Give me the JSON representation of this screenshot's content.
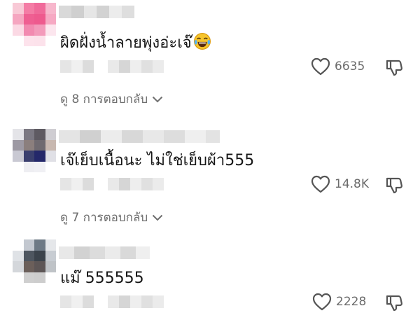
{
  "comments": [
    {
      "text": "ผิดฝั่งน้ำลายพุ่งอ่ะเจ๊",
      "emoji": "face-with-tears-of-joy-icon",
      "likes": "6635",
      "replies_label": "ดู 8 การตอบกลับ",
      "avatar_colors": [
        "#f8c9d6",
        "#f47ca5",
        "#f06a9a",
        "#f7b7cc",
        "#f5a6c0",
        "#ef5f92",
        "#ee5a8e",
        "#f6a9c3",
        "#fbd9e4",
        "#f28ab0",
        "#f39bbb",
        "#fce6ee",
        "#ffffff",
        "#fde3ec",
        "#fce2eb",
        "#ffffff"
      ]
    },
    {
      "text": "เจ๊เย็บเนื้อนะ ไม่ใช่เย็บผ้า555",
      "likes": "14.8K",
      "replies_label": "ดู 7 การตอบกลับ",
      "avatar_colors": [
        "#e4e4e8",
        "#7b7882",
        "#5e5a62",
        "#cfcdd2",
        "#9d99a3",
        "#8b7f7d",
        "#6f6a70",
        "#c8b8b0",
        "#c9c9d3",
        "#3a3f6e",
        "#24286a",
        "#e0e0e6",
        "#ffffff",
        "#eeeef2",
        "#f0f0f4",
        "#ffffff"
      ]
    },
    {
      "text": "แม๊ 555555",
      "likes": "2228",
      "avatar_colors": [
        "#ffffff",
        "#c3c8d0",
        "#6e7a86",
        "#e5e7ea",
        "#dfe2e6",
        "#4e5660",
        "#3b434c",
        "#c7ccd2",
        "#d4d7db",
        "#6b5f5a",
        "#5d5656",
        "#bfc3c7",
        "#ffffff",
        "#cfcfcf",
        "#cdcdcd",
        "#ffffff"
      ]
    }
  ],
  "colors": {
    "text": "#161616",
    "muted": "#6e6e6e",
    "icon": "#555555"
  }
}
